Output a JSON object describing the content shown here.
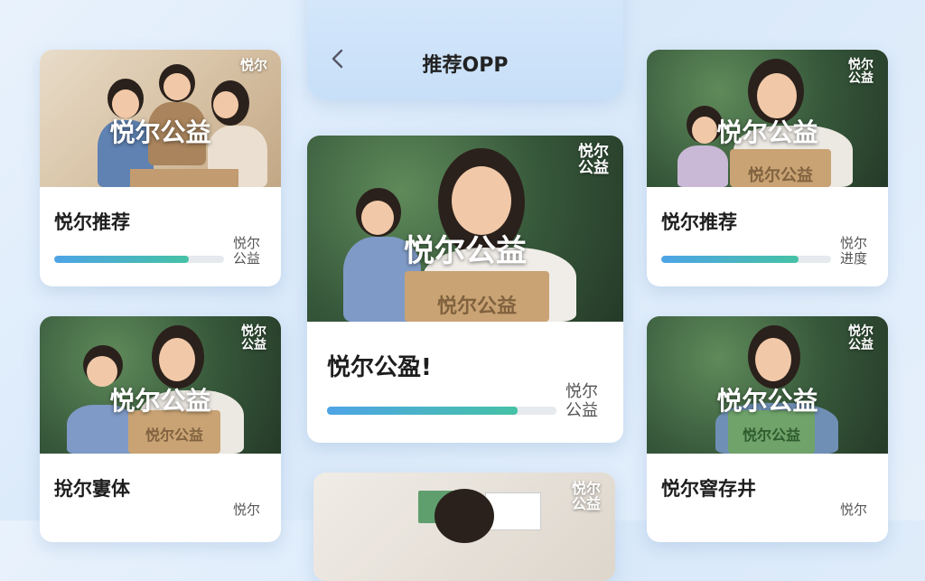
{
  "header": {
    "title": "推荐OPP"
  },
  "cards": [
    {
      "title": "悦尔推荐",
      "overlay": "悦尔公益",
      "badge": "悦尔",
      "side_label": "悦尔\n公益",
      "progress": 0.79
    },
    {
      "title": "悦尔推荐",
      "overlay": "悦尔公益",
      "badge": "悦尔\n公益",
      "side_label": "悦尔\n进度",
      "progress": 0.81,
      "sign_text": "悦尔公益"
    },
    {
      "title": "悦尔公盈!",
      "overlay": "悦尔公益",
      "badge": "悦尔\n公益",
      "side_label": "悦尔\n公益",
      "progress": 0.83,
      "sign_text": "悦尔公益"
    },
    {
      "title": "挩尔寠体",
      "overlay": "悦尔公益",
      "badge": "悦尔\n公益",
      "side_label": "悦尔",
      "sign_text": "悦尔公益"
    },
    {
      "title": "悦尔窨存井",
      "overlay": "悦尔公益",
      "badge": "悦尔\n公益",
      "side_label": "悦尔",
      "sign_text": "悦尔公益"
    },
    {
      "badge": "悦尔\n公益"
    }
  ],
  "colors": {
    "accent_start": "#4ea4e6",
    "accent_end": "#45c2a6"
  }
}
